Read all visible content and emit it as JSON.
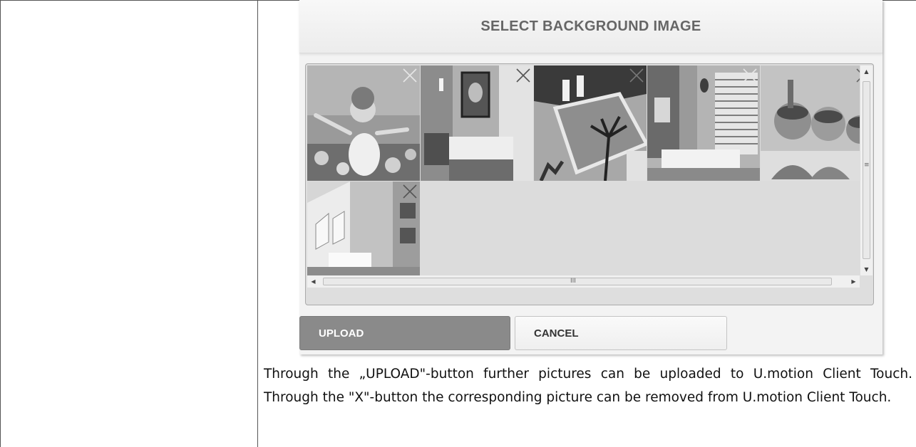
{
  "dialog": {
    "title": "SELECT BACKGROUND IMAGE",
    "upload_label": "UPLOAD",
    "cancel_label": "CANCEL"
  },
  "gallery": {
    "thumbnails": [
      {
        "subject": "girl in flower field",
        "remove_icon": "close-x-icon"
      },
      {
        "subject": "bedroom with framed portrait",
        "remove_icon": "close-x-icon"
      },
      {
        "subject": "swimming pool with palm trees",
        "remove_icon": "close-x-icon"
      },
      {
        "subject": "living room with window blinds",
        "remove_icon": "close-x-icon"
      },
      {
        "subject": "children with snorkel masks on beach",
        "remove_icon": "close-x-icon"
      },
      {
        "subject": "attic living room with skylights",
        "remove_icon": "close-x-icon"
      }
    ],
    "vertical_grip": "≡",
    "horizontal_grip": "III"
  },
  "description": {
    "text": "Through the „UPLOAD\"-button further pictures can be uploaded to U.motion Client Touch. Through the \"X\"-button the corresponding picture can be removed from U.motion Client Touch."
  }
}
